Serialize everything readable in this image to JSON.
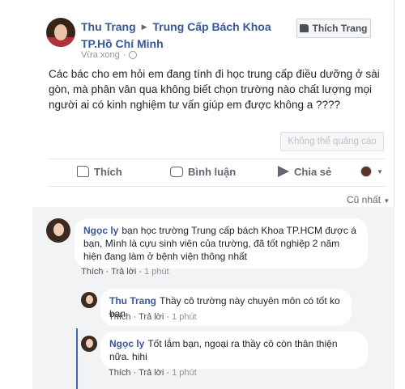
{
  "post": {
    "author": "Thu Trang",
    "separator_glyph": "▶",
    "target": "Trung Cấp Bách Khoa TP.Hồ Chí Minh",
    "time": "Vừa xong",
    "like_page_label": "Thích Trang",
    "text": "Các bác cho em hỏi em đang tính đi học trung cấp điều dưỡng ở sài gòn, mà phân vân qua không biết chọn trường nào chất lượng mọi người ai có kinh nghiệm tư vấn giúp em được không a ????",
    "ad_label": "Không thể quảng cáo"
  },
  "actions": {
    "like": "Thích",
    "comment": "Bình luận",
    "share": "Chia sẻ"
  },
  "comments_sort": "Cũ nhất",
  "comments": [
    {
      "author": "Ngọc ly",
      "text": "bạn học trường Trung cấp bách Khoa TP.HCM được á bạn, Mình là cựu sinh viên của trường, đã tốt nghiệp 2 năm hiện đang làm ở bệnh viện thông nhất",
      "like": "Thích",
      "reply": "Trả lời",
      "time": "1 phút"
    },
    {
      "author": "Thu Trang",
      "text": "Thầy cô trường này chuyên môn có tốt ko bạn",
      "like": "Thích",
      "reply": "Trả lời",
      "time": "1 phút"
    },
    {
      "author": "Ngọc ly",
      "text": "Tốt lắm bạn, ngoại ra thầy cô còn thân thiện nữa. hihi",
      "like": "Thích",
      "reply": "Trả lời",
      "time": "1 phút"
    }
  ],
  "colors": {
    "link": "#365899",
    "muted": "#90949c",
    "comment_bg": "#f2f3f5",
    "reply_bar": "#4267b2"
  },
  "icons": [
    "like-icon",
    "comment-icon",
    "share-icon",
    "globe-icon",
    "chevron-down-icon"
  ]
}
